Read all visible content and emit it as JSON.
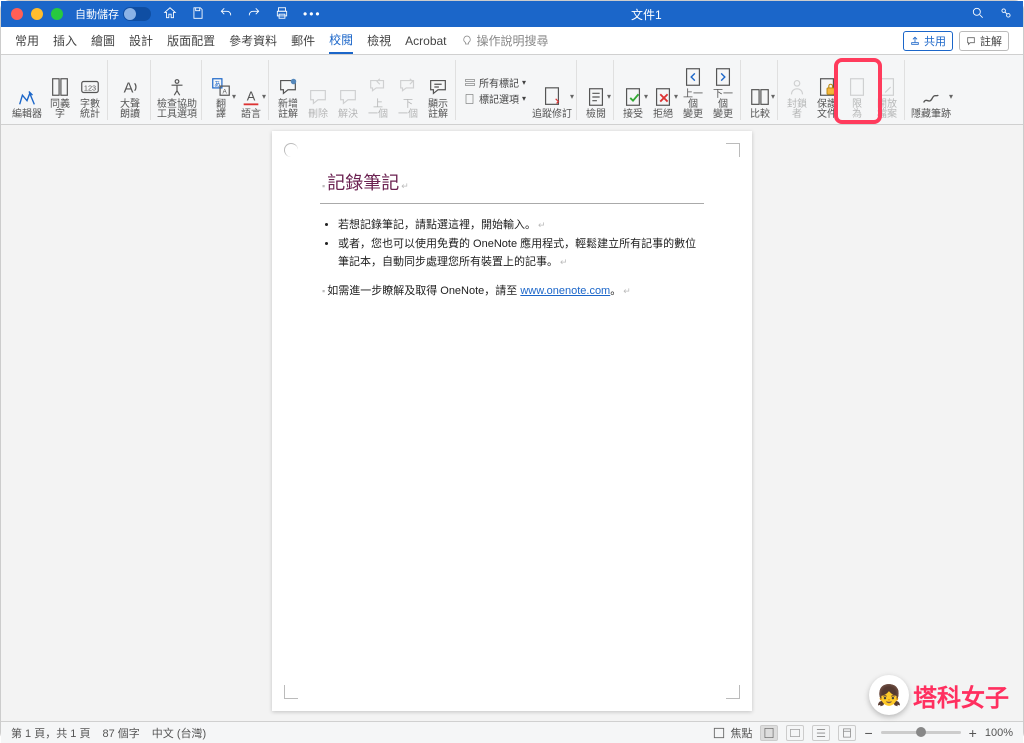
{
  "titlebar": {
    "autosave_label": "自動儲存",
    "doc_title": "文件1"
  },
  "tabs": {
    "items": [
      "常用",
      "插入",
      "繪圖",
      "設計",
      "版面配置",
      "參考資料",
      "郵件",
      "校閱",
      "檢視",
      "Acrobat"
    ],
    "active_index": 7,
    "tell_me": "操作說明搜尋",
    "share": "共用",
    "comments": "註解"
  },
  "ribbon": {
    "editor": "編輯器",
    "thesaurus": "同義\n字",
    "word_count": "字數\n統計",
    "read_aloud": "大聲\n朗讀",
    "accessibility": "檢查協助\n工具選項",
    "translate": "翻\n譯",
    "language": "語言",
    "new_comment": "新增\n註解",
    "delete": "刪除",
    "resolve": "解決",
    "prev": "上\n一個",
    "next": "下\n一個",
    "show_comments": "顯示\n註解",
    "track_changes": "追蹤修訂",
    "display_for_review": "所有標記",
    "show_markup": "標記選項",
    "review_pane": "檢閱",
    "accept": "接受",
    "reject": "拒絕",
    "prev_change": "上一個\n變更",
    "next_change": "下一個\n變更",
    "compare": "比較",
    "block_authors": "封鎖\n者",
    "protect": "保護\n文件",
    "restrict": "限\n為",
    "open_file": "開放\n檔案",
    "hide_ink": "隱藏筆跡"
  },
  "document": {
    "heading": "記錄筆記",
    "bullet1": "若想記錄筆記，請點選這裡，開始輸入。",
    "bullet2_a": "或者，您也可以使用免費的 OneNote 應用程式，輕鬆建立所有記事的數位筆記本，自動同步處理您所有裝置上的記事。",
    "note_prefix": "如需進一步瞭解及取得 OneNote，請至 ",
    "note_link": "www.onenote.com",
    "note_suffix": "。"
  },
  "statusbar": {
    "page_info": "第 1 頁，共 1 頁",
    "word_count": "87 個字",
    "language": "中文 (台灣)",
    "focus": "焦點",
    "zoom": "100%"
  },
  "watermark": "塔科女子"
}
